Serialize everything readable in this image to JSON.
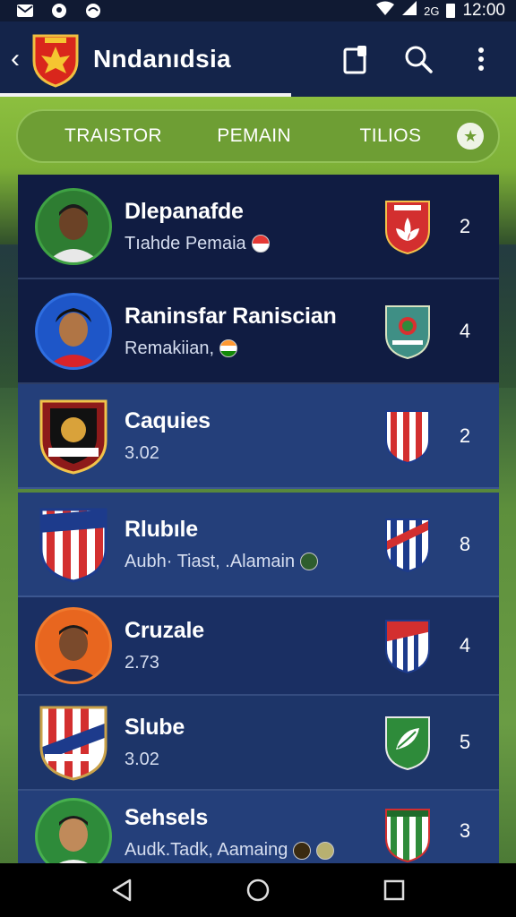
{
  "status_bar": {
    "time": "12:00",
    "network": "2G",
    "icons": [
      "mail-icon",
      "location-icon",
      "sync-icon",
      "wifi-icon",
      "signal-icon",
      "battery-icon"
    ]
  },
  "app_bar": {
    "title": "Nndanıdsia",
    "icons": [
      "back-icon",
      "club-crest-icon",
      "bookmark-icon",
      "search-icon",
      "more-icon"
    ]
  },
  "tabs": {
    "items": [
      {
        "label": "TRAISTOR"
      },
      {
        "label": "PEMAIN"
      },
      {
        "label": "TILIOS"
      }
    ],
    "favorite_icon": "star-icon"
  },
  "list": {
    "rows": [
      {
        "name": "Dlepanafde",
        "subtitle": "Tıahde Pemaia",
        "count": "2",
        "avatar_type": "player",
        "badge_icon": "flower-crest-icon"
      },
      {
        "name": "Raninsfar Raniscian",
        "subtitle": "Remakiian,",
        "count": "4",
        "avatar_type": "player",
        "badge_icon": "green-shield-crest-icon"
      },
      {
        "name": "Caquies",
        "subtitle": "3.02",
        "count": "2",
        "avatar_type": "crest",
        "badge_icon": "red-stripes-crest-icon"
      },
      {
        "name": "Rlubıle",
        "subtitle": "Aubh· Tiast,  .Alamain",
        "count": "8",
        "avatar_type": "crest",
        "badge_icon": "red-blue-stripes-crest-icon"
      },
      {
        "name": "Cruzale",
        "subtitle": "2.73",
        "count": "4",
        "avatar_type": "player",
        "badge_icon": "red-white-stripes-crest-icon"
      },
      {
        "name": "Slube",
        "subtitle": "3.02",
        "count": "5",
        "avatar_type": "crest",
        "badge_icon": "green-leaf-crest-icon"
      },
      {
        "name": "Sehsels",
        "subtitle": "Audk.Tadk,  Aamaing",
        "count": "3",
        "avatar_type": "player",
        "badge_icon": "green-white-stripes-crest-icon"
      }
    ]
  },
  "nav_bar": {
    "icons": [
      "back-triangle-icon",
      "home-circle-icon",
      "recents-square-icon"
    ]
  },
  "colors": {
    "app_bar": "#14244a",
    "tabs_pill": "#6e9e34",
    "row_dark": "#101c42",
    "row_mid": "#243f7a"
  }
}
